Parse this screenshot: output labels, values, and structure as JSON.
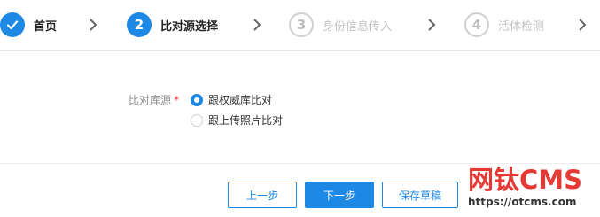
{
  "steps": [
    {
      "index": "✓",
      "label": "首页",
      "state": "done"
    },
    {
      "index": "2",
      "label": "比对源选择",
      "state": "active"
    },
    {
      "index": "3",
      "label": "身份信息传入",
      "state": "todo"
    },
    {
      "index": "4",
      "label": "活体检测",
      "state": "todo"
    }
  ],
  "form": {
    "source_label": "比对库源",
    "required_mark": "*",
    "options": [
      {
        "label": "跟权威库比对",
        "checked": true
      },
      {
        "label": "跟上传照片比对",
        "checked": false
      }
    ]
  },
  "buttons": {
    "prev": "上一步",
    "next": "下一步",
    "save": "保存草稿"
  },
  "watermark": {
    "title": "网钛CMS",
    "url": "https://otcms.com"
  },
  "colors": {
    "accent": "#1e88e5",
    "inactive": "#c2c2c2",
    "required": "#f5222d",
    "watermark": "#e53935"
  }
}
